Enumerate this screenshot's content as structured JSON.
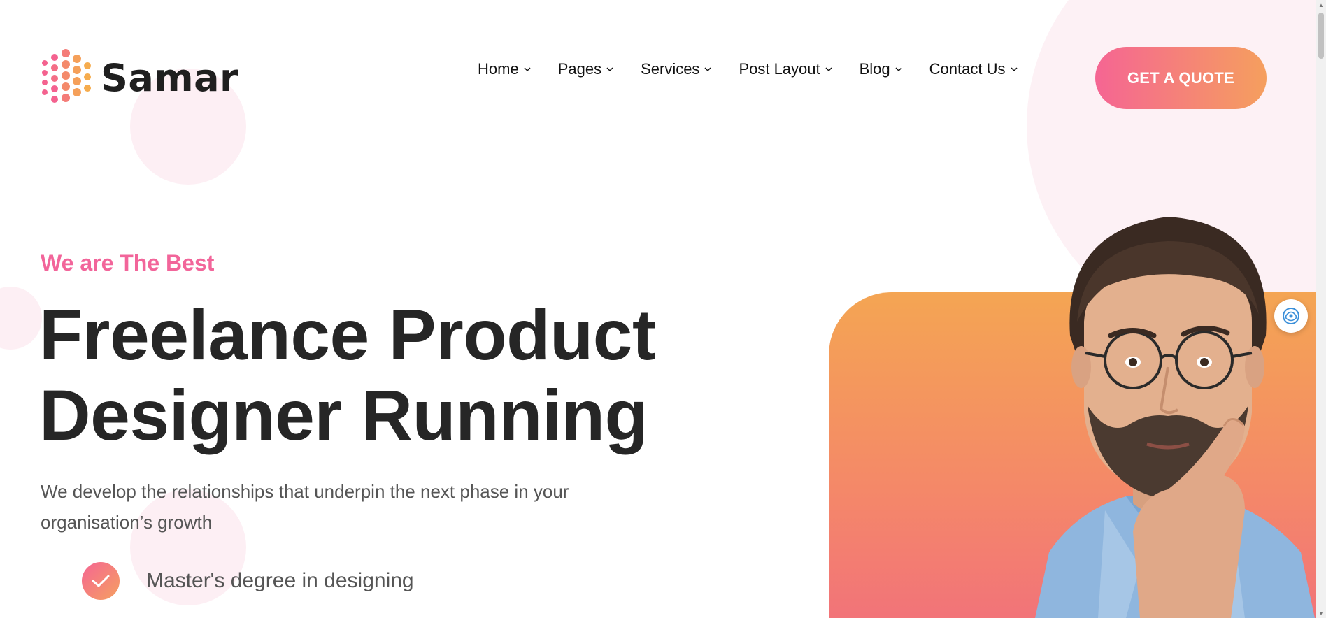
{
  "brand": {
    "name": "Samar"
  },
  "nav": {
    "items": [
      {
        "label": "Home"
      },
      {
        "label": "Pages"
      },
      {
        "label": "Services"
      },
      {
        "label": "Post Layout"
      },
      {
        "label": "Blog"
      },
      {
        "label": "Contact Us"
      }
    ]
  },
  "header": {
    "cta_label": "GET A QUOTE"
  },
  "hero": {
    "eyebrow": "We are The Best",
    "headline_line1": "Freelance Product",
    "headline_line2": "Designer Running",
    "subtitle": "We develop the relationships that underpin the next phase in your organisation’s growth",
    "features": [
      {
        "label": "Master's degree in designing",
        "icon": "check-icon"
      }
    ]
  },
  "colors": {
    "accent_pink": "#f2659a",
    "accent_orange": "#f59f5e",
    "heading": "#262626",
    "body_text": "#555555"
  },
  "icons": {
    "logo": "hexagon-dots-logo-icon",
    "dropdown": "chevron-down-icon",
    "chat": "chat-assistant-icon"
  }
}
